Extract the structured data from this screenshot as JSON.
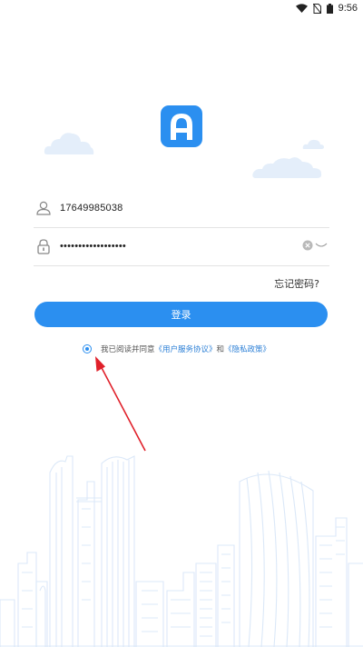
{
  "status_bar": {
    "time": "9:56"
  },
  "login": {
    "phone_value": "17649985038",
    "password_mask": "••••••••••••••••••",
    "forgot_label": "忘记密码?",
    "login_button": "登录",
    "agreement": {
      "prefix": "我已阅读并同意",
      "service_link": "《用户服务协议》",
      "conjunction": "和",
      "privacy_link": "《隐私政策》"
    }
  },
  "colors": {
    "accent": "#2b8ff0",
    "annotation_arrow": "#e0202a",
    "cloud": "#e4eefa",
    "skyline": "#dbe8f8"
  },
  "icons": [
    "wifi-icon",
    "no-sim-icon",
    "battery-icon",
    "app-logo-icon",
    "user-icon",
    "lock-icon",
    "clear-icon",
    "eye-closed-icon"
  ]
}
